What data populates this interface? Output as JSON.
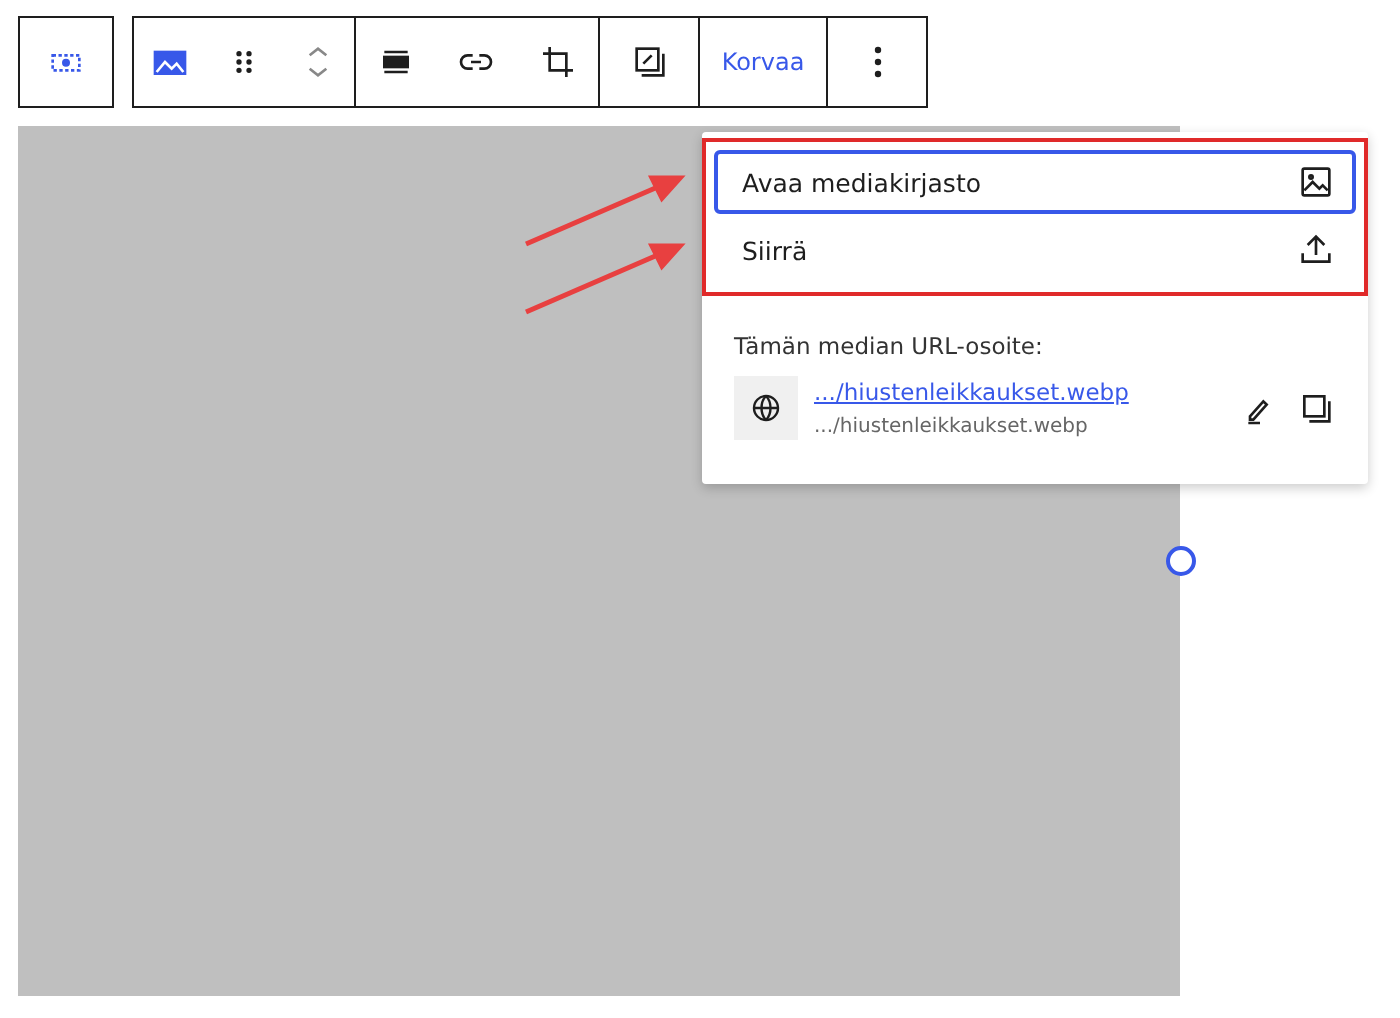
{
  "toolbar": {
    "replace_label": "Korvaa"
  },
  "menu": {
    "items": [
      {
        "label": "Avaa mediakirjasto",
        "kind": "library",
        "selected": true
      },
      {
        "label": "Siirrä",
        "kind": "upload",
        "selected": false
      }
    ]
  },
  "media_url": {
    "heading": "Tämän median URL-osoite:",
    "link": ".../hiustenleikkaukset.webp",
    "filename": ".../hiustenleikkaukset.webp"
  }
}
